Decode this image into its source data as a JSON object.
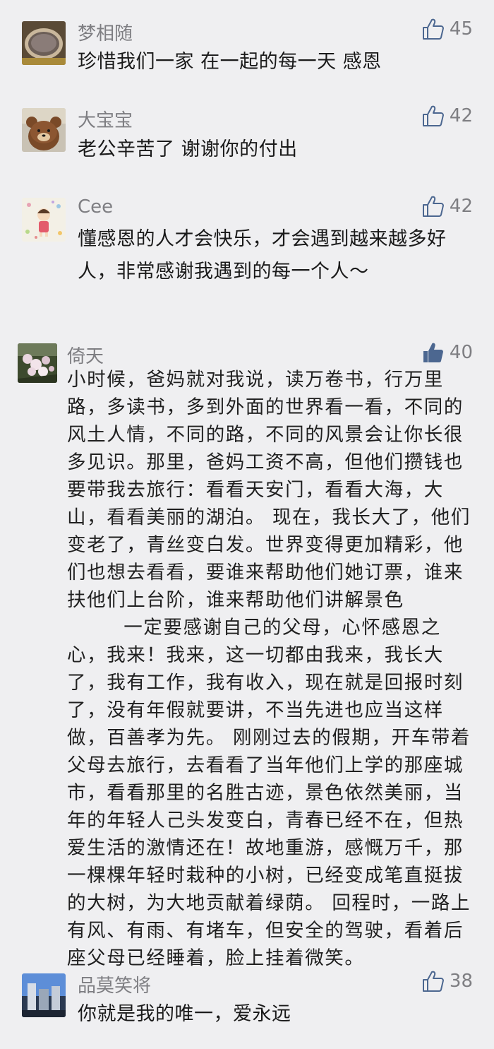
{
  "comments": [
    {
      "user": "梦相随",
      "likes": "45",
      "liked": false,
      "text": "珍惜我们一家 在一起的每一天 感恩",
      "avatar": "avatar-pot"
    },
    {
      "user": "大宝宝",
      "likes": "42",
      "liked": false,
      "text": "老公辛苦了 谢谢你的付出",
      "avatar": "avatar-bear"
    },
    {
      "user": "Cee",
      "likes": "42",
      "liked": false,
      "text": "懂感恩的人才会快乐，才会遇到越来越多好人，非常感谢我遇到的每一个人～",
      "avatar": "avatar-cartoon"
    },
    {
      "user": "倚天",
      "likes": "40",
      "liked": true,
      "text": "小时候，爸妈就对我说，读万卷书，行万里路，多读书，多到外面的世界看一看，不同的风土人情，不同的路，不同的风景会让你长很多见识。那里，爸妈工资不高，但他们攒钱也要带我去旅行：看看天安门，看看大海，大山，看看美丽的湖泊。 现在，我长大了，他们变老了，青丝变白发。世界变得更加精彩，他们也想去看看，要谁来帮助他们她订票，谁来扶他们上台阶，谁来帮助他们讲解景色\n        一定要感谢自己的父母，心怀感恩之心，我来！我来，这一切都由我来，我长大了，我有工作，我有收入，现在就是回报时刻了，没有年假就要讲，不当先进也应当这样做，百善孝为先。 刚刚过去的假期，开车带着父母去旅行，去看看了当年他们上学的那座城市，看看那里的名胜古迹，景色依然美丽，当年的年轻人己头发变白，青春已经不在，但热爱生活的激情还在！故地重游，感慨万千，那一棵棵年轻时栽种的小树，已经变成笔直挺拔的大树，为大地贡献着绿荫。 回程时，一路上有风、有雨、有堵车，但安全的驾驶，看着后座父母已经睡着，脸上挂着微笑。",
      "avatar": "avatar-blossom"
    },
    {
      "user": "品莫笑将",
      "likes": "38",
      "liked": false,
      "text": "你就是我的唯一，爱永远",
      "avatar": "avatar-building"
    }
  ],
  "icons": {
    "like_outline": "thumbs-up-outline-icon",
    "like_filled": "thumbs-up-filled-icon"
  },
  "colors": {
    "background": "#efeff1",
    "name_text": "#7e7e82",
    "body_text": "#1a1a1a",
    "like_active": "#4c6790"
  }
}
